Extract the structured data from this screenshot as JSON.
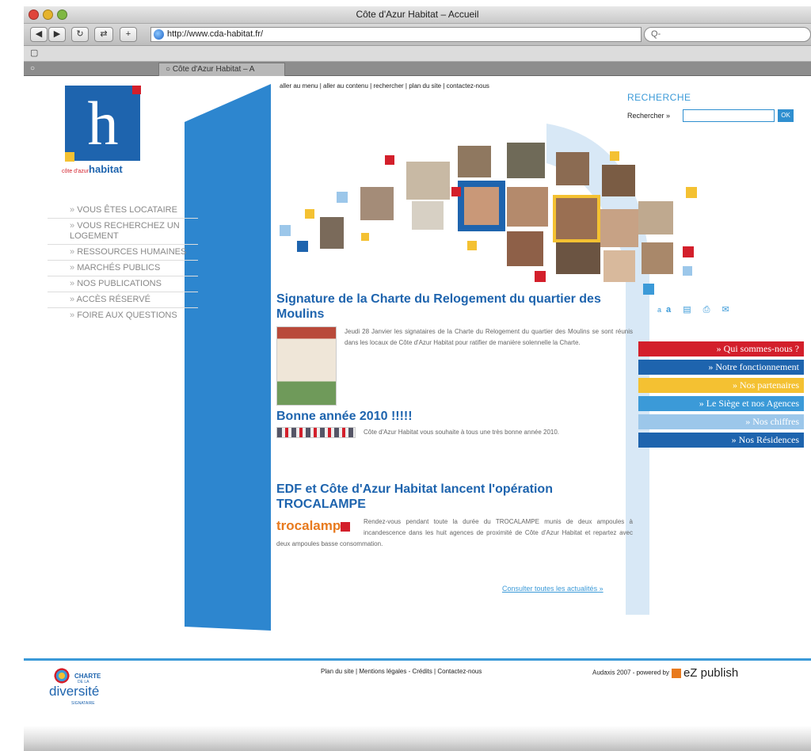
{
  "browser": {
    "window_title": "Côte d'Azur Habitat – Accueil",
    "url": "http://www.cda-habitat.fr/",
    "search_placeholder": "Q-",
    "bookmark_icon": "book-icon",
    "tab_label": "Côte d'Azur Habitat – A"
  },
  "logo": {
    "letter": "h",
    "prefix": "côte d'azur",
    "brand": "habitat"
  },
  "menu": [
    {
      "label": "VOUS ÊTES LOCATAIRE"
    },
    {
      "label": "VOUS RECHERCHEZ UN LOGEMENT"
    },
    {
      "label": "RESSOURCES HUMAINES"
    },
    {
      "label": "MARCHÉS PUBLICS"
    },
    {
      "label": "NOS PUBLICATIONS"
    },
    {
      "label": "ACCÈS RÉSERVÉ"
    },
    {
      "label": "FOIRE AUX QUESTIONS"
    }
  ],
  "skiplinks": "aller au menu | aller au contenu | rechercher | plan du site | contactez-nous",
  "search": {
    "title": "RECHERCHE",
    "label": "Rechercher »",
    "value": "",
    "button": "OK"
  },
  "news": [
    {
      "title": "Signature de la Charte du Relogement du quartier des Moulins",
      "body": "Jeudi 28 Janvier les signataires de la Charte du Relogement du quartier des Moulins se sont réunis dans les locaux de Côte d'Azur Habitat pour ratifier de manière solennelle la Charte."
    },
    {
      "title": "Bonne année 2010 !!!!!",
      "body": "Côte d'Azur Habitat vous souhaite à tous une très bonne année 2010."
    },
    {
      "title": "EDF et Côte d'Azur Habitat lancent l'opération TROCALAMPE",
      "body": "Rendez-vous pendant toute la durée du TROCALAMPE munis de deux ampoules à incandescence dans les huit agences de proximité de Côte d'Azur Habitat et repartez avec deux ampoules basse consommation."
    }
  ],
  "more_link": "Consulter toutes les actualités",
  "tools": "a a",
  "right_nav": [
    {
      "label": "» Qui sommes-nous ?",
      "color": "#d31f2b"
    },
    {
      "label": "» Notre fonctionnement",
      "color": "#1e64ae"
    },
    {
      "label": "» Nos partenaires",
      "color": "#f4c132"
    },
    {
      "label": "» Le Siège et nos Agences",
      "color": "#3b9ad8"
    },
    {
      "label": "» Nos chiffres",
      "color": "#9cc7ea"
    },
    {
      "label": "» Nos Résidences",
      "color": "#1e64ae"
    }
  ],
  "footer": {
    "links": "Plan du site | Mentions légales - Crédits | Contactez-nous",
    "credit": "Audaxis 2007 - powered by",
    "ez": "eZ publish",
    "charte_small": "CHARTE",
    "charte_mid": "DE LA",
    "charte_big": "diversité",
    "charte_sign": "SIGNATAIRE"
  }
}
